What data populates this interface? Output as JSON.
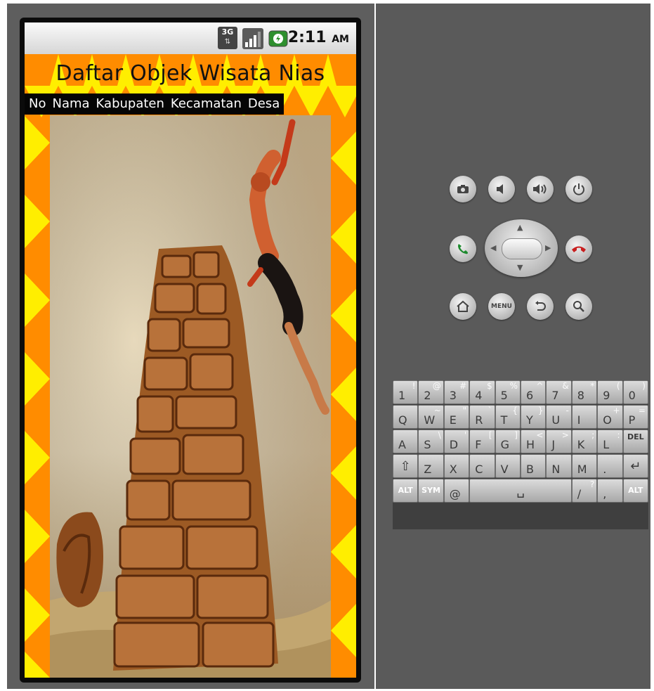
{
  "status_bar": {
    "network_label": "3G",
    "time": "2:11",
    "ampm": "AM"
  },
  "app": {
    "title": "Daftar Objek Wisata Nias",
    "columns": [
      "No",
      "Nama",
      "Kabupaten",
      "Kecamatan",
      "Desa"
    ]
  },
  "colors": {
    "zigzag_orange": "#ff8c00",
    "zigzag_yellow": "#ffee00",
    "header_bg": "#050505",
    "emulator_bg": "#5e5e5e"
  },
  "hardware_buttons": [
    {
      "name": "camera-button",
      "icon": "camera-icon"
    },
    {
      "name": "volume-down-button",
      "icon": "volume-down-icon"
    },
    {
      "name": "volume-up-button",
      "icon": "volume-up-icon"
    },
    {
      "name": "power-button",
      "icon": "power-icon"
    },
    {
      "name": "call-button",
      "icon": "call-icon"
    },
    {
      "name": "end-call-button",
      "icon": "end-call-icon"
    },
    {
      "name": "home-button",
      "icon": "home-icon"
    },
    {
      "name": "menu-button",
      "icon": "menu-icon"
    },
    {
      "name": "back-button",
      "icon": "back-icon"
    },
    {
      "name": "search-button",
      "icon": "search-icon"
    }
  ],
  "menu_label": "MENU",
  "keyboard": {
    "row1": [
      {
        "m": "1",
        "a": "!"
      },
      {
        "m": "2",
        "a": "@"
      },
      {
        "m": "3",
        "a": "#"
      },
      {
        "m": "4",
        "a": "$"
      },
      {
        "m": "5",
        "a": "%"
      },
      {
        "m": "6",
        "a": "^"
      },
      {
        "m": "7",
        "a": "&"
      },
      {
        "m": "8",
        "a": "*"
      },
      {
        "m": "9",
        "a": "("
      },
      {
        "m": "0",
        "a": ")"
      }
    ],
    "row2": [
      {
        "m": "Q",
        "a": ""
      },
      {
        "m": "W",
        "a": "~"
      },
      {
        "m": "E",
        "a": "\""
      },
      {
        "m": "R",
        "a": "`"
      },
      {
        "m": "T",
        "a": "{"
      },
      {
        "m": "Y",
        "a": "}"
      },
      {
        "m": "U",
        "a": "-"
      },
      {
        "m": "I",
        "a": ""
      },
      {
        "m": "O",
        "a": "+"
      },
      {
        "m": "P",
        "a": "="
      }
    ],
    "row3": [
      {
        "m": "A",
        "a": ""
      },
      {
        "m": "S",
        "a": "\\"
      },
      {
        "m": "D",
        "a": "'"
      },
      {
        "m": "F",
        "a": "["
      },
      {
        "m": "G",
        "a": "]"
      },
      {
        "m": "H",
        "a": "<"
      },
      {
        "m": "J",
        "a": ">"
      },
      {
        "m": "K",
        "a": ";"
      },
      {
        "m": "L",
        "a": ":"
      }
    ],
    "row4": [
      {
        "m": "Z",
        "a": ""
      },
      {
        "m": "X",
        "a": ""
      },
      {
        "m": "C",
        "a": ""
      },
      {
        "m": "V",
        "a": ""
      },
      {
        "m": "B",
        "a": ""
      },
      {
        "m": "N",
        "a": ""
      },
      {
        "m": "M",
        "a": ""
      },
      {
        "m": ".",
        "a": ""
      }
    ],
    "del_label": "DEL",
    "alt_label": "ALT",
    "sym_label": "SYM",
    "at_label": "@",
    "slash_label": "/",
    "slash_alt": "?",
    "comma_label": ","
  }
}
